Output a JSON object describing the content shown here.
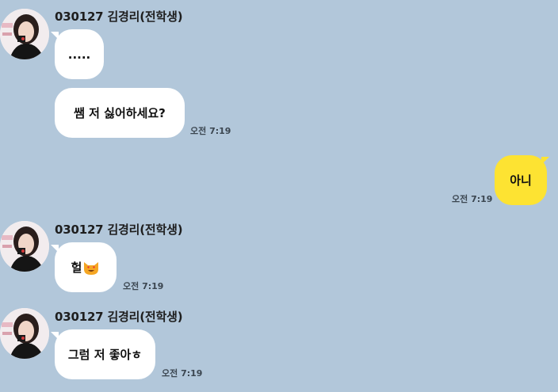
{
  "sender": {
    "name": "030127 김경리(전학생)"
  },
  "messages": [
    {
      "from": "them",
      "text": "....."
    },
    {
      "from": "them",
      "text": "쌤 저 싫어하세요?",
      "time": "오전 7:19"
    },
    {
      "from": "me",
      "text": "아니",
      "time": "오전 7:19"
    },
    {
      "from": "them",
      "text": "헐",
      "emoji": "smiling-cat-heart-eyes-icon",
      "time": "오전 7:19"
    },
    {
      "from": "them",
      "text": "그럼 저 좋아ㅎ",
      "time": "오전 7:19"
    }
  ],
  "colors": {
    "background": "#b2c7da",
    "their_bubble": "#ffffff",
    "my_bubble": "#fde332"
  }
}
